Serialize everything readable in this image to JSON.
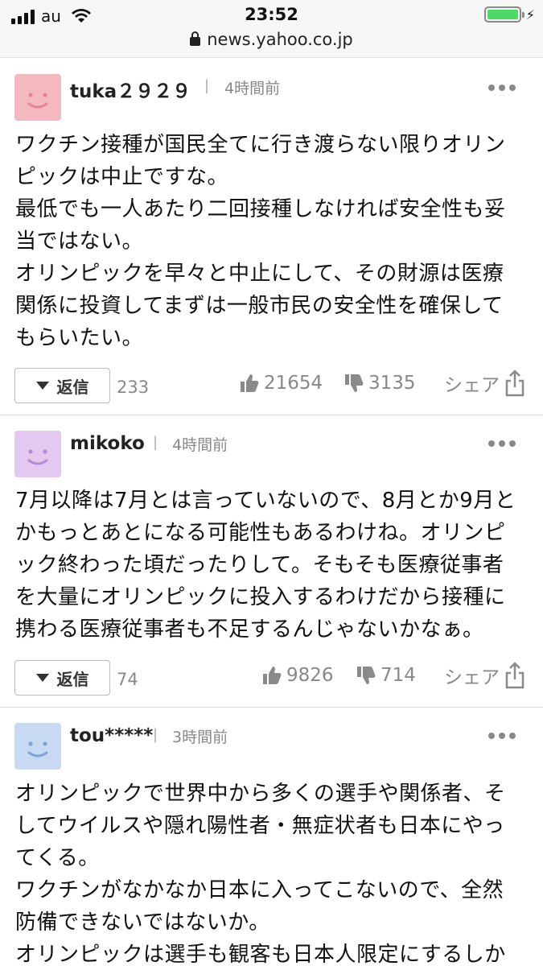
{
  "status_bar": {
    "carrier": "au",
    "time": "23:52",
    "battery_level": 1.0,
    "battery_color": "#4cd964"
  },
  "url_bar": {
    "url": "news.yahoo.co.jp"
  },
  "comments": [
    {
      "username": "tuka２９２９",
      "time": "4時間前",
      "avatar_color": "#f4b9be",
      "avatar_face_color": "#e8848d",
      "lines": [
        "ワクチン接種が国民全てに行き渡らない限りオリン",
        "ピックは中止ですな。",
        "最低でも一人あたり二回接種しなければ安全性も妥",
        "当ではない。",
        "オリンピックを早々と中止にして、その財源は医療",
        "関係に投資してまずは一般市民の安全性を確保して",
        "もらいたい。"
      ],
      "reply_label": "返信",
      "reply_count": "233",
      "likes": "21654",
      "dislikes": "3135",
      "share_label": "シェア"
    },
    {
      "username": "mikoko",
      "time": "4時間前",
      "avatar_color": "#e3c8ef",
      "avatar_face_color": "#b98ad1",
      "lines": [
        "7月以降は7月とは言っていないので、8月とか9月と",
        "かもっとあとになる可能性もあるわけね。オリンピ",
        "ック終わった頃だったりして。そもそも医療従事者",
        "を大量にオリンピックに投入するわけだから接種に",
        "携わる医療従事者も不足するんじゃないかなぁ。"
      ],
      "reply_label": "返信",
      "reply_count": "74",
      "likes": "9826",
      "dislikes": "714",
      "share_label": "シェア"
    },
    {
      "username": "tou*****",
      "time": "3時間前",
      "avatar_color": "#c8d9f2",
      "avatar_face_color": "#7ea3d6",
      "lines": [
        "オリンピックで世界中から多くの選手や関係者、そ",
        "してウイルスや隠れ陽性者・無症状者も日本にやっ",
        "てくる。",
        "ワクチンがなかなか日本に入ってこないので、全然",
        "防備できないではないか。",
        "オリンピックは選手も観客も日本人限定にするしか"
      ]
    }
  ]
}
